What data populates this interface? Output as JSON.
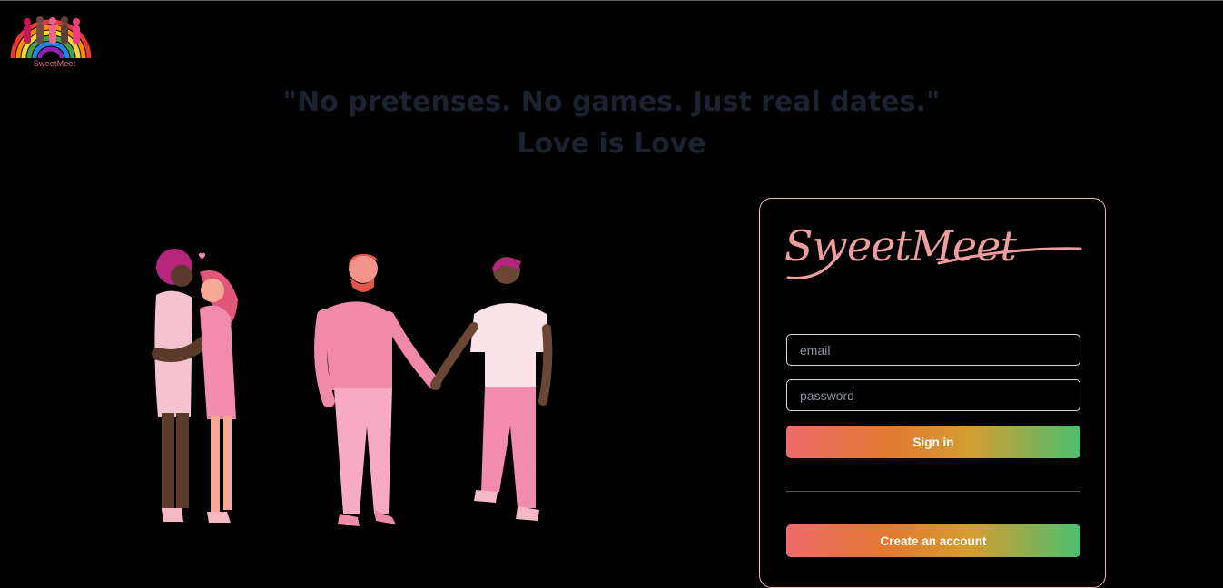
{
  "header": {
    "logo_text": "SweetMeet"
  },
  "hero": {
    "tagline_line1": "\"No pretenses. No games. Just real dates.\"",
    "tagline_line2": "Love is Love"
  },
  "login": {
    "brand_script": "SweetMeet",
    "email_placeholder": "email",
    "password_placeholder": "password",
    "sign_in_label": "Sign in",
    "create_account_label": "Create an account"
  },
  "colors": {
    "background": "#000000",
    "card_border": "#f1b8be",
    "brand_pink": "#ef9ea0",
    "tagline": "#1b2230",
    "gradient_start": "#ef6b6b",
    "gradient_mid": "#e07a32",
    "gradient_end": "#4cbf70"
  }
}
